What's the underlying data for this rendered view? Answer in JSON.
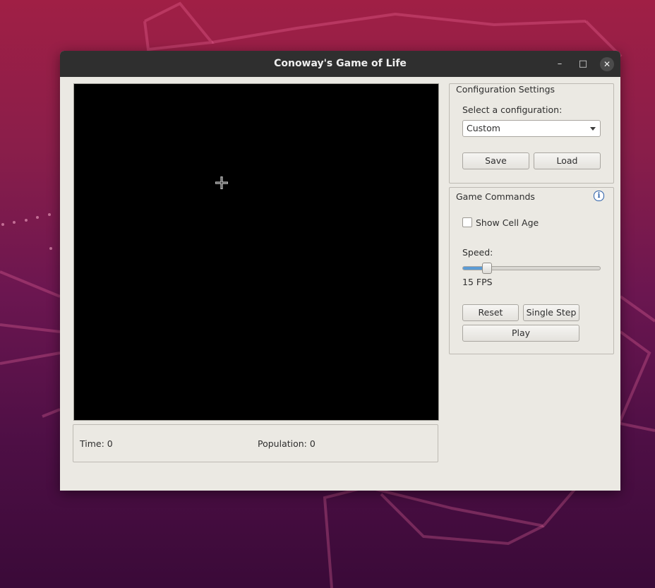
{
  "window": {
    "title": "Conoway's Game of Life",
    "minimize_glyph": "–",
    "maximize_glyph": "□",
    "close_glyph": "✕"
  },
  "status": {
    "time": "Time: 0",
    "population": "Population: 0"
  },
  "config": {
    "group_title": "Configuration Settings",
    "select_label": "Select a configuration:",
    "selected": "Custom",
    "save_label": "Save",
    "load_label": "Load"
  },
  "commands": {
    "group_title": "Game Commands",
    "info_glyph": "i",
    "show_cell_age_label": "Show Cell Age",
    "show_cell_age_checked": false,
    "speed_label": "Speed:",
    "speed_value_text": "15 FPS",
    "speed_fraction": 0.17,
    "reset_label": "Reset",
    "single_step_label": "Single Step",
    "play_label": "Play"
  },
  "colors": {
    "canvas": "#000000",
    "window_bg": "#ebe9e3",
    "titlebar": "#2f2f2f",
    "slider_fill": "#5b9bd5",
    "info_icon": "#2a5ea8"
  }
}
